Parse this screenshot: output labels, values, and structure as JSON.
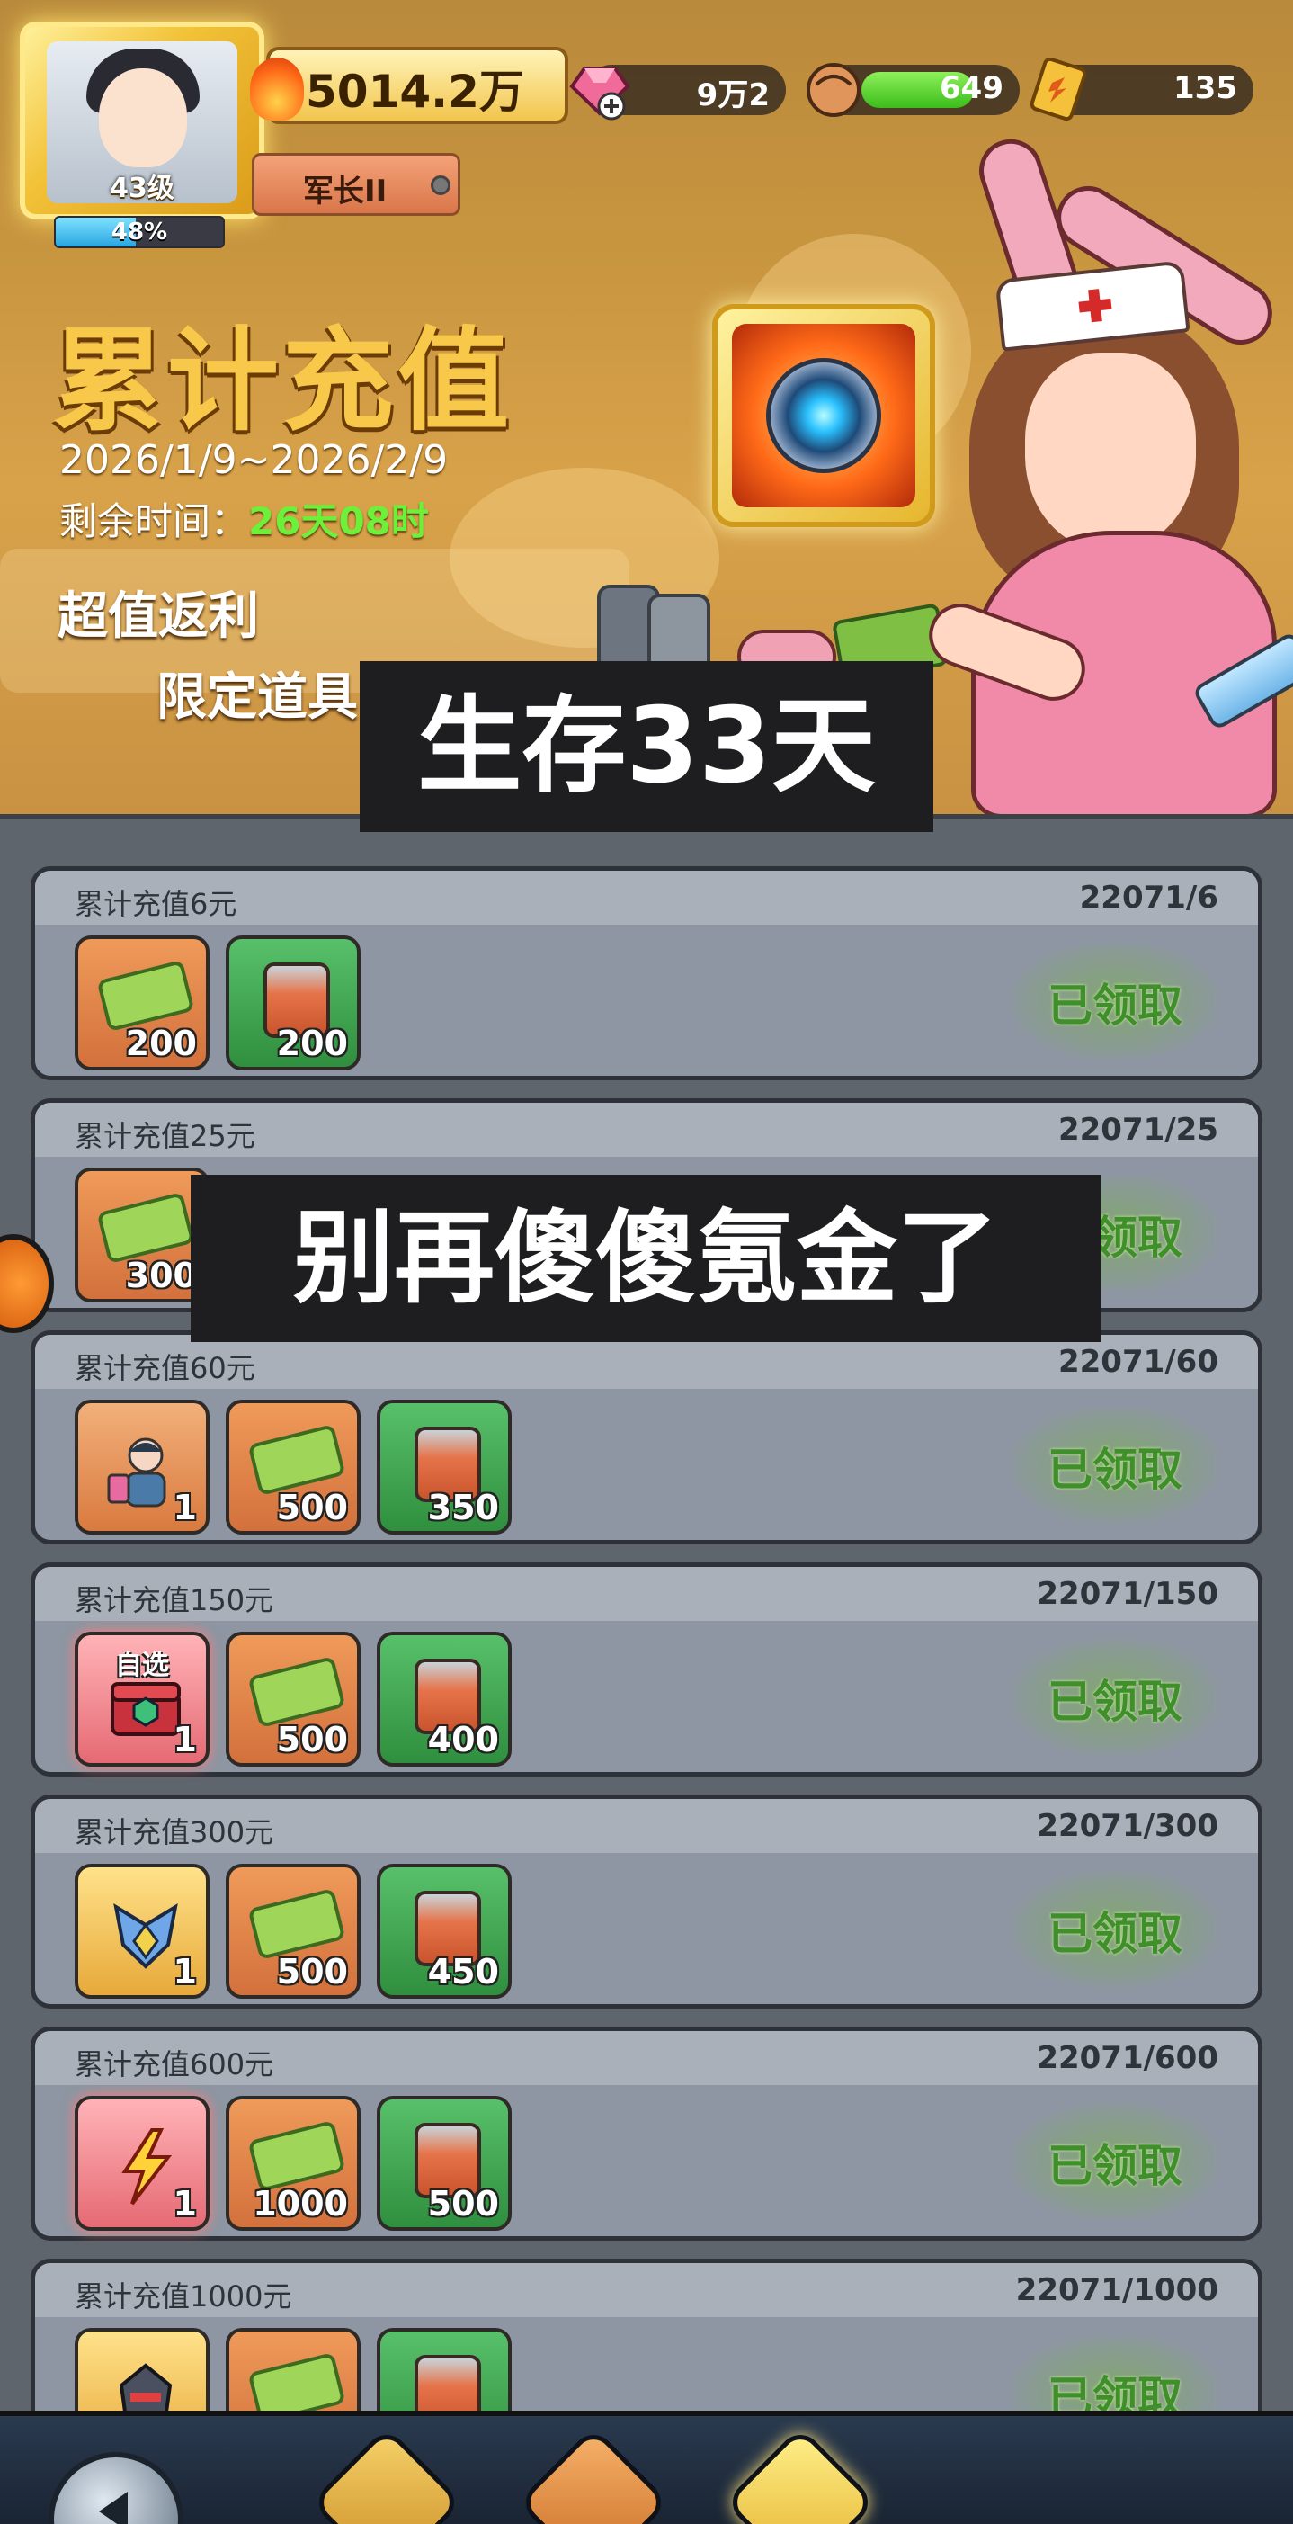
{
  "player": {
    "level": "43级",
    "exp_text": "48%",
    "exp_progress": 0.48,
    "power": "5014.2万",
    "rank": "军长II"
  },
  "resources": {
    "gems": "9万2",
    "stamina": "649",
    "stamina_fill": 0.78,
    "tickets": "135"
  },
  "event": {
    "title": "累计充值",
    "dates": "2026/1/9~2026/2/9",
    "remaining_label": "剩余时间：",
    "remaining_value": "26天08时",
    "promo_line1": "超值返利",
    "promo_line2": "限定道具"
  },
  "captions": {
    "top": "生存33天",
    "middle": "别再傻傻氪金了"
  },
  "tiers": [
    {
      "title": "累计充值6元",
      "progress": "22071/6",
      "status": "已领取",
      "items": [
        {
          "kind": "cash",
          "count": "200"
        },
        {
          "kind": "can",
          "count": "200"
        }
      ]
    },
    {
      "title": "累计充值25元",
      "progress": "22071/25",
      "status": "已领取",
      "items": [
        {
          "kind": "cash",
          "count": "300"
        }
      ]
    },
    {
      "title": "累计充值60元",
      "progress": "22071/60",
      "status": "已领取",
      "items": [
        {
          "kind": "special-orange",
          "icon": "character-icon",
          "count": "1"
        },
        {
          "kind": "cash",
          "count": "500"
        },
        {
          "kind": "can",
          "count": "350"
        }
      ]
    },
    {
      "title": "累计充值150元",
      "progress": "22071/150",
      "status": "已领取",
      "items": [
        {
          "kind": "special-red",
          "icon": "selectable-chest-icon",
          "tag": "自选",
          "count": "1"
        },
        {
          "kind": "cash",
          "count": "500"
        },
        {
          "kind": "can",
          "count": "400"
        }
      ]
    },
    {
      "title": "累计充值300元",
      "progress": "22071/300",
      "status": "已领取",
      "items": [
        {
          "kind": "special-gold",
          "icon": "mech-icon",
          "count": "1"
        },
        {
          "kind": "cash",
          "count": "500"
        },
        {
          "kind": "can",
          "count": "450"
        }
      ]
    },
    {
      "title": "累计充值600元",
      "progress": "22071/600",
      "status": "已领取",
      "items": [
        {
          "kind": "special-red",
          "icon": "lightning-icon",
          "count": "1"
        },
        {
          "kind": "cash",
          "count": "1000"
        },
        {
          "kind": "can",
          "count": "500"
        }
      ]
    },
    {
      "title": "累计充值1000元",
      "progress": "22071/1000",
      "status": "已领取",
      "items": [
        {
          "kind": "special-gold",
          "icon": "robot-head-icon",
          "count": ""
        },
        {
          "kind": "cash",
          "count": ""
        },
        {
          "kind": "can",
          "count": ""
        }
      ]
    }
  ]
}
